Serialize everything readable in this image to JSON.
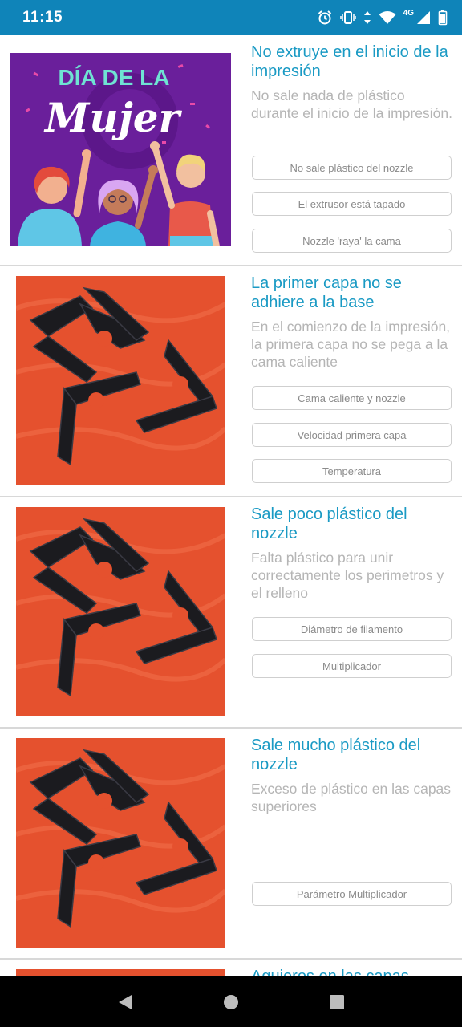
{
  "status_bar": {
    "time": "11:15",
    "network": "4G"
  },
  "cards": [
    {
      "title": "No extruye en el inicio de la impresión",
      "description": "No sale nada de plástico durante el inicio de la impresión.",
      "image": {
        "banner_line1": "DÍA DE LA",
        "banner_line2": "Mujer"
      },
      "options": [
        "No sale plástico del nozzle",
        "El extrusor está tapado",
        "Nozzle 'raya' la cama"
      ]
    },
    {
      "title": "La primer capa no se adhiere a la base",
      "description": "En el comienzo de la impresión, la primera capa no se pega a la cama caliente",
      "options": [
        "Cama caliente y nozzle",
        "Velocidad primera capa",
        "Temperatura"
      ]
    },
    {
      "title": "Sale poco plástico del nozzle",
      "description": "Falta plástico para unir correctamente los perimetros y el relleno",
      "options": [
        "Diámetro de filamento",
        "Multiplicador"
      ]
    },
    {
      "title": "Sale mucho plástico del nozzle",
      "description": "Exceso de plástico en las capas superiores",
      "options": [
        "Parámetro Multiplicador"
      ]
    },
    {
      "title": "Agujeros en las capas",
      "description": "",
      "options": []
    }
  ],
  "colors": {
    "accent": "#1a9ac4",
    "status_bar": "#0f84b9",
    "photo_bg": "#e5512e"
  }
}
